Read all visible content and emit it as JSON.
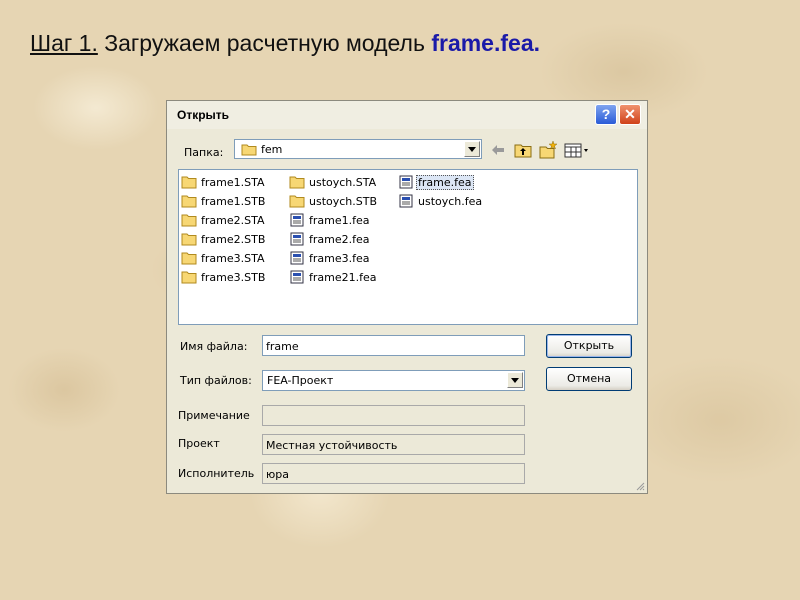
{
  "heading": {
    "step": "Шаг 1.",
    "text": "Загружаем расчетную модель",
    "filename": "frame.fea",
    "end": "."
  },
  "dialog": {
    "title": "Открыть",
    "help_glyph": "?",
    "close_glyph": "✕",
    "folder_label": "Папка:",
    "folder_value": "fem",
    "files_col1": [
      "frame1.STA",
      "frame1.STB",
      "frame2.STA",
      "frame2.STB",
      "frame3.STA",
      "frame3.STB"
    ],
    "files_col2": [
      "ustoych.STA",
      "ustoych.STB",
      "frame1.fea",
      "frame2.fea",
      "frame3.fea",
      "frame21.fea"
    ],
    "files_col3": [
      "frame.fea",
      "ustoych.fea"
    ],
    "filename_label": "Имя файла:",
    "filename_value": "frame",
    "filetype_label": "Тип файлов:",
    "filetype_value": "FEA-Проект",
    "note_label": "Примечание",
    "note_value": "",
    "project_label": "Проект",
    "project_value": "Местная устойчивость",
    "author_label": "Исполнитель",
    "author_value": "юра",
    "open_button": "Открыть",
    "cancel_button": "Отмена"
  }
}
